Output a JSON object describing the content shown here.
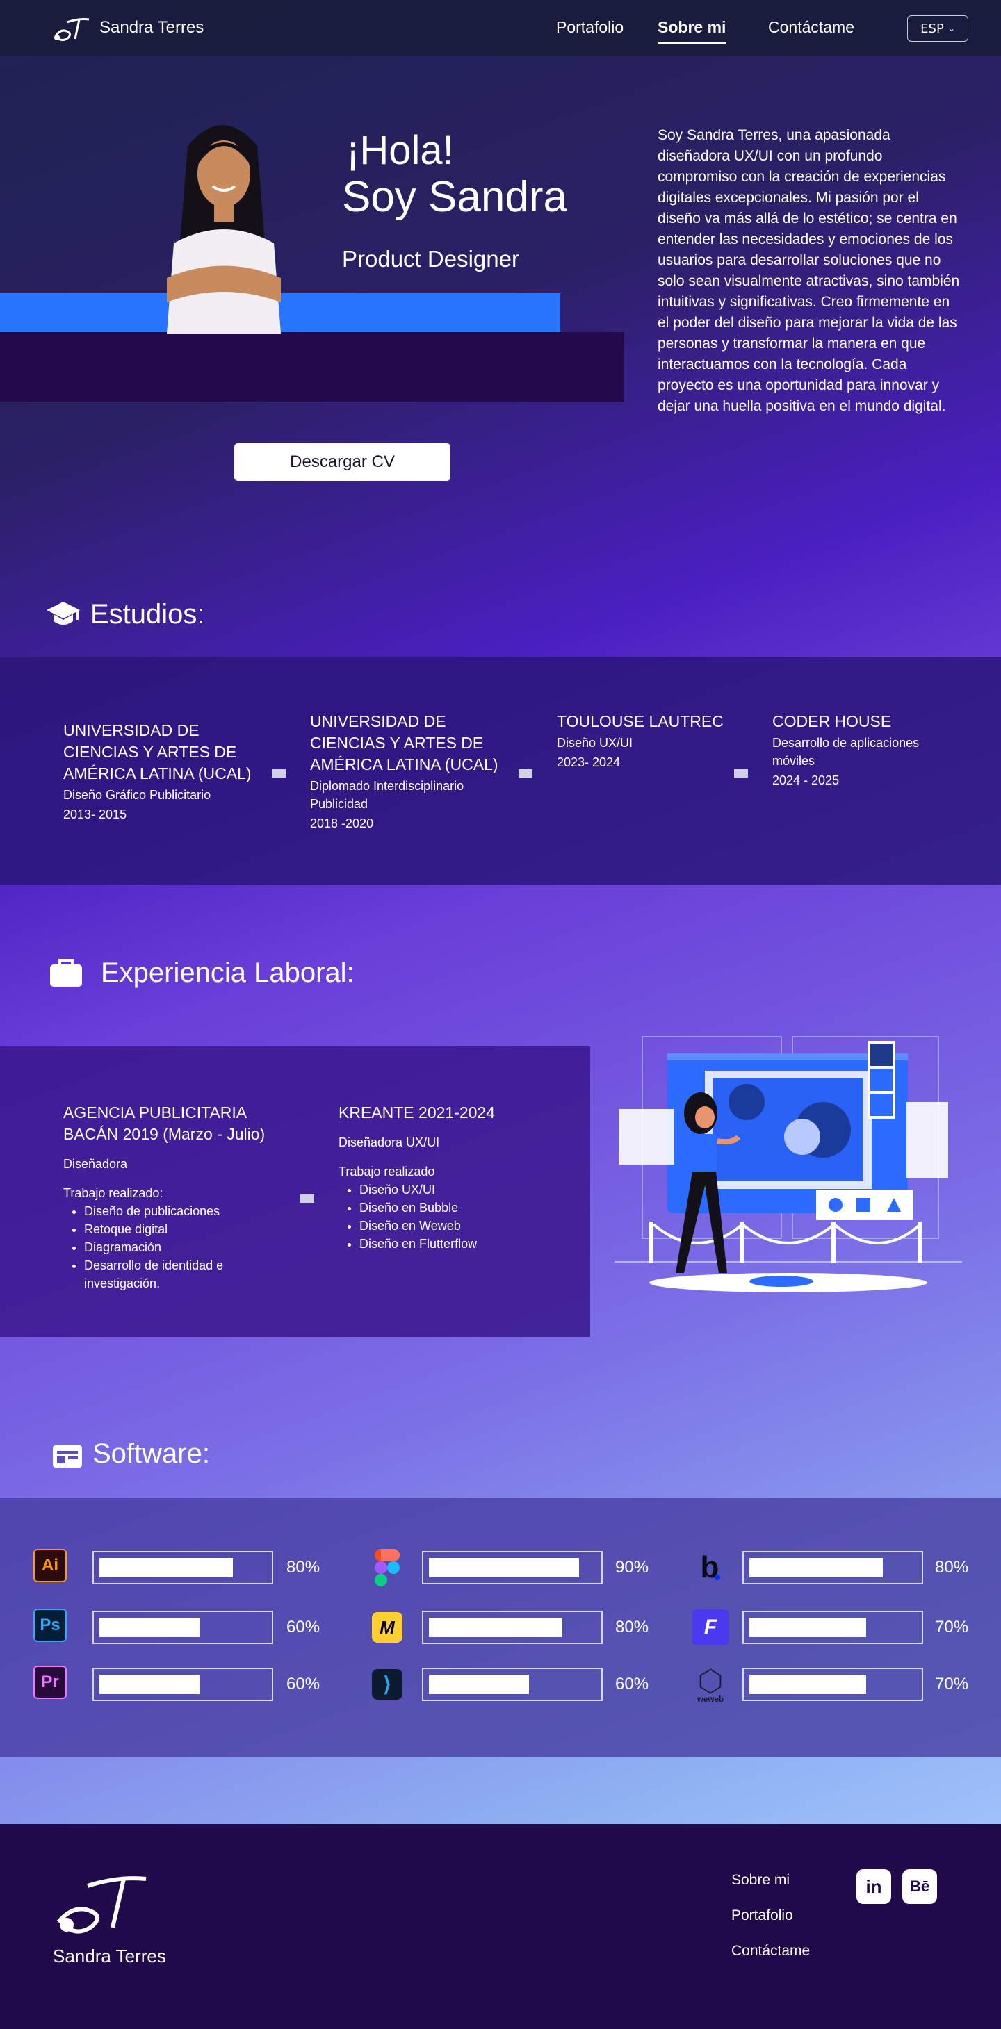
{
  "nav": {
    "brand": "Sandra Terres",
    "links": [
      "Portafolio",
      "Sobre mi",
      "Contáctame"
    ],
    "language": "ESP"
  },
  "hero": {
    "greeting": "¡Hola!",
    "name": "Soy Sandra",
    "role": "Product Designer",
    "bio": "Soy Sandra Terres, una apasionada diseñadora UX/UI con un profundo compromiso con la creación de experiencias digitales excepcionales. Mi pasión por el diseño va más allá de lo estético; se centra en entender las necesidades y emociones de los usuarios para desarrollar soluciones que no solo sean visualmente atractivas, sino también intuitivas y significativas. Creo firmemente en el poder del diseño para mejorar la vida de las personas y transformar la manera en que interactuamos con la tecnología. Cada proyecto es una oportunidad para innovar y dejar una huella positiva en el mundo digital.",
    "cv_button": "Descargar CV"
  },
  "studies": {
    "title": "Estudios:",
    "items": [
      {
        "name": "UNIVERSIDAD DE CIENCIAS Y ARTES DE AMÉRICA LATINA (UCAL)",
        "detail": "Diseño Gráfico Publicitario",
        "years": "2013- 2015"
      },
      {
        "name": "UNIVERSIDAD DE CIENCIAS Y ARTES DE AMÉRICA LATINA (UCAL)",
        "detail": "Diplomado Interdisciplinario Publicidad",
        "years": "2018 -2020"
      },
      {
        "name": "TOULOUSE LAUTREC",
        "detail": "Diseño UX/UI",
        "years": "2023- 2024"
      },
      {
        "name": "CODER HOUSE",
        "detail": "Desarrollo de aplicaciones móviles",
        "years": "2024 - 2025"
      }
    ]
  },
  "experience": {
    "title": "Experiencia Laboral:",
    "items": [
      {
        "company": "AGENCIA PUBLICITARIA BACÁN 2019 (Marzo - Julio)",
        "position": "Diseñadora",
        "work_label": "Trabajo realizado:",
        "tasks": [
          "Diseño de publicaciones",
          "Retoque digital",
          "Diagramación",
          "Desarrollo de identidad e investigación."
        ]
      },
      {
        "company": "KREANTE 2021-2024",
        "position": "Diseñadora UX/UI",
        "work_label": "Trabajo realizado",
        "tasks": [
          "Diseño UX/UI",
          "Diseño en Bubble",
          "Diseño en Weweb",
          "Diseño en Flutterflow"
        ]
      }
    ]
  },
  "software": {
    "title": "Software:",
    "items": [
      {
        "icon": "illustrator-icon",
        "icon_text": "Ai",
        "color": "#ff9a00",
        "level": 0.8,
        "label": "80%"
      },
      {
        "icon": "figma-icon",
        "icon_text": "",
        "color": "#a259ff",
        "level": 0.9,
        "label": "90%"
      },
      {
        "icon": "bubble-icon",
        "icon_text": "b",
        "color": "#0a2bf5",
        "level": 0.8,
        "label": "80%"
      },
      {
        "icon": "photoshop-icon",
        "icon_text": "Ps",
        "color": "#31a8ff",
        "level": 0.6,
        "label": "60%"
      },
      {
        "icon": "miro-icon",
        "icon_text": "",
        "color": "#ffd02f",
        "level": 0.8,
        "label": "80%"
      },
      {
        "icon": "flutterflow-icon",
        "icon_text": "",
        "color": "#4b39ef",
        "level": 0.7,
        "label": "70%"
      },
      {
        "icon": "premiere-icon",
        "icon_text": "Pr",
        "color": "#ea77ff",
        "level": 0.6,
        "label": "60%"
      },
      {
        "icon": "vscode-icon",
        "icon_text": "",
        "color": "#23a9f2",
        "level": 0.6,
        "label": "60%"
      },
      {
        "icon": "weweb-icon",
        "icon_text": "weweb",
        "color": "#1a1a2e",
        "level": 0.7,
        "label": "70%"
      }
    ]
  },
  "footer": {
    "name": "Sandra Terres",
    "links": [
      "Sobre mi",
      "Portafolio",
      "Contáctame"
    ],
    "social": [
      "in",
      "Bē"
    ]
  }
}
